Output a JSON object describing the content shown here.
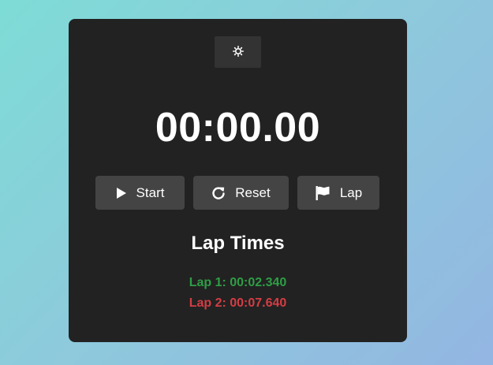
{
  "theme_toggle": {
    "icon": "sun-icon",
    "icon_color": "#ffffff"
  },
  "timer": {
    "display": "00:00.00"
  },
  "controls": {
    "start_label": "Start",
    "start_icon": "play-icon",
    "reset_label": "Reset",
    "reset_icon": "rotate-right-icon",
    "lap_label": "Lap",
    "lap_icon": "flag-icon"
  },
  "laps": {
    "title": "Lap Times",
    "items": [
      {
        "text": "Lap 1: 00:02.340",
        "color": "#2e9e45"
      },
      {
        "text": "Lap 2: 00:07.640",
        "color": "#d43d44"
      }
    ]
  },
  "colors": {
    "card_bg": "#222222",
    "button_bg": "#444444",
    "text": "#ffffff"
  }
}
